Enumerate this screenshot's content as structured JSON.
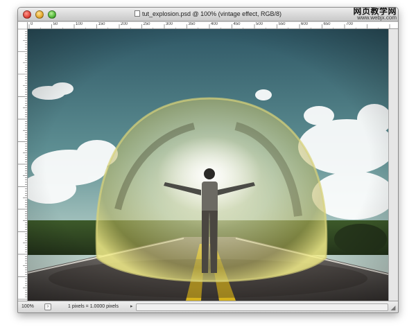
{
  "window": {
    "title": "tut_explosion.psd @ 100% (vintage effect, RGB/8)"
  },
  "watermark": {
    "site_name": "网页教学网",
    "url": "www.webjx.com"
  },
  "ruler": {
    "horizontal_labels": [
      "0",
      "50",
      "100",
      "150",
      "200",
      "250",
      "300",
      "350",
      "400",
      "450",
      "500",
      "550",
      "600",
      "650",
      "700"
    ]
  },
  "status": {
    "zoom": "100%",
    "pixel_info": "1 pixels = 1.0000 pixels"
  },
  "icons": {
    "close": "close-icon",
    "minimize": "minimize-icon",
    "maximize": "maximize-icon",
    "document": "document-icon",
    "status_menu": "status-menu-icon",
    "resize": "resize-grip-icon"
  },
  "colors": {
    "sky_top": "#3c6a7a",
    "sky_bottom": "#a9c6c1",
    "bubble": "#e8e48a",
    "road": "#5a5552",
    "road_line": "#e9c21c"
  }
}
